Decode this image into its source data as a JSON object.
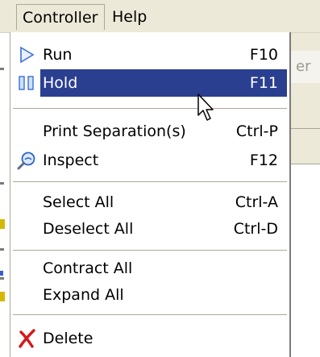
{
  "menubar": {
    "items": [
      {
        "label": "Controller",
        "state": "open"
      },
      {
        "label": "Help"
      }
    ]
  },
  "menu": {
    "items": [
      {
        "label": "Run",
        "shortcut": "F10",
        "icon": "play-icon"
      },
      {
        "label": "Hold",
        "shortcut": "F11",
        "icon": "pause-icon",
        "highlighted": true
      },
      {
        "label": "Print Separation(s)",
        "shortcut": "Ctrl-P"
      },
      {
        "label": "Inspect",
        "shortcut": "F12",
        "icon": "magnifier-icon"
      },
      {
        "label": "Select All",
        "shortcut": "Ctrl-A"
      },
      {
        "label": "Deselect All",
        "shortcut": "Ctrl-D"
      },
      {
        "label": "Contract All"
      },
      {
        "label": "Expand All"
      },
      {
        "label": "Delete",
        "icon": "delete-x-icon"
      }
    ]
  },
  "background": {
    "panel_header_fragment": "er"
  },
  "colors": {
    "menubar_bg": "#ece9d8",
    "highlight_bg": "#2a3f8f",
    "highlight_text": "#ffffff",
    "separator": "#aca899",
    "delete_icon": "#d11a1a",
    "play_icon": "#3a6fd8"
  }
}
